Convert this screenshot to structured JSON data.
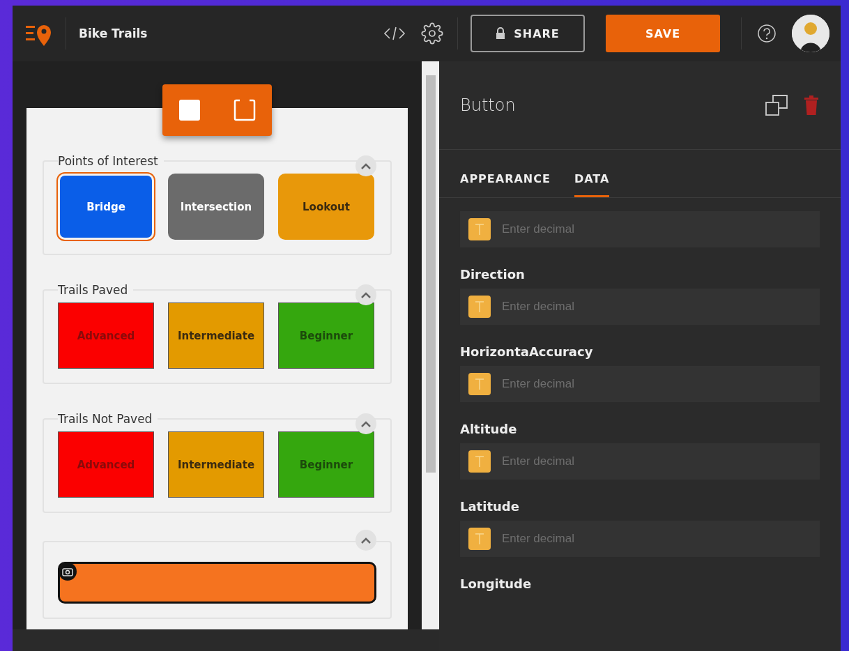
{
  "header": {
    "title": "Bike Trails",
    "share": "SHARE",
    "save": "SAVE"
  },
  "canvas": {
    "groups": [
      {
        "title": "Points of Interest",
        "expanded": true,
        "kind": "rounded",
        "buttons": [
          {
            "label": "Bridge",
            "color": "#0a5ee8",
            "selected": true
          },
          {
            "label": "Intersection",
            "color": "#6b6b6b",
            "selected": false
          },
          {
            "label": "Lookout",
            "color": "#e8980a",
            "selected": false
          }
        ]
      },
      {
        "title": "Trails Paved",
        "expanded": true,
        "kind": "square",
        "buttons": [
          {
            "label": "Advanced",
            "color": "#fb0000",
            "selected": false
          },
          {
            "label": "Intermediate",
            "color": "#e39a00",
            "selected": false
          },
          {
            "label": "Beginner",
            "color": "#35a70e",
            "selected": false
          }
        ]
      },
      {
        "title": "Trails Not Paved",
        "expanded": true,
        "kind": "square",
        "buttons": [
          {
            "label": "Advanced",
            "color": "#fb0000",
            "selected": false
          },
          {
            "label": "Intermediate",
            "color": "#e39a00",
            "selected": false
          },
          {
            "label": "Beginner",
            "color": "#35a70e",
            "selected": false
          }
        ]
      },
      {
        "expanded": true,
        "kind": "image"
      }
    ]
  },
  "panel": {
    "title": "Button",
    "tabs": [
      {
        "label": "APPEARANCE",
        "selected": false
      },
      {
        "label": "DATA",
        "selected": true
      }
    ],
    "fields": [
      {
        "placeholder": "Enter decimal"
      },
      {
        "label": "Direction",
        "placeholder": "Enter decimal"
      },
      {
        "label": "HorizontaAccuracy",
        "placeholder": "Enter decimal"
      },
      {
        "label": "Altitude",
        "placeholder": "Enter decimal"
      },
      {
        "label": "Latitude",
        "placeholder": "Enter decimal"
      },
      {
        "label": "Longitude"
      }
    ]
  }
}
